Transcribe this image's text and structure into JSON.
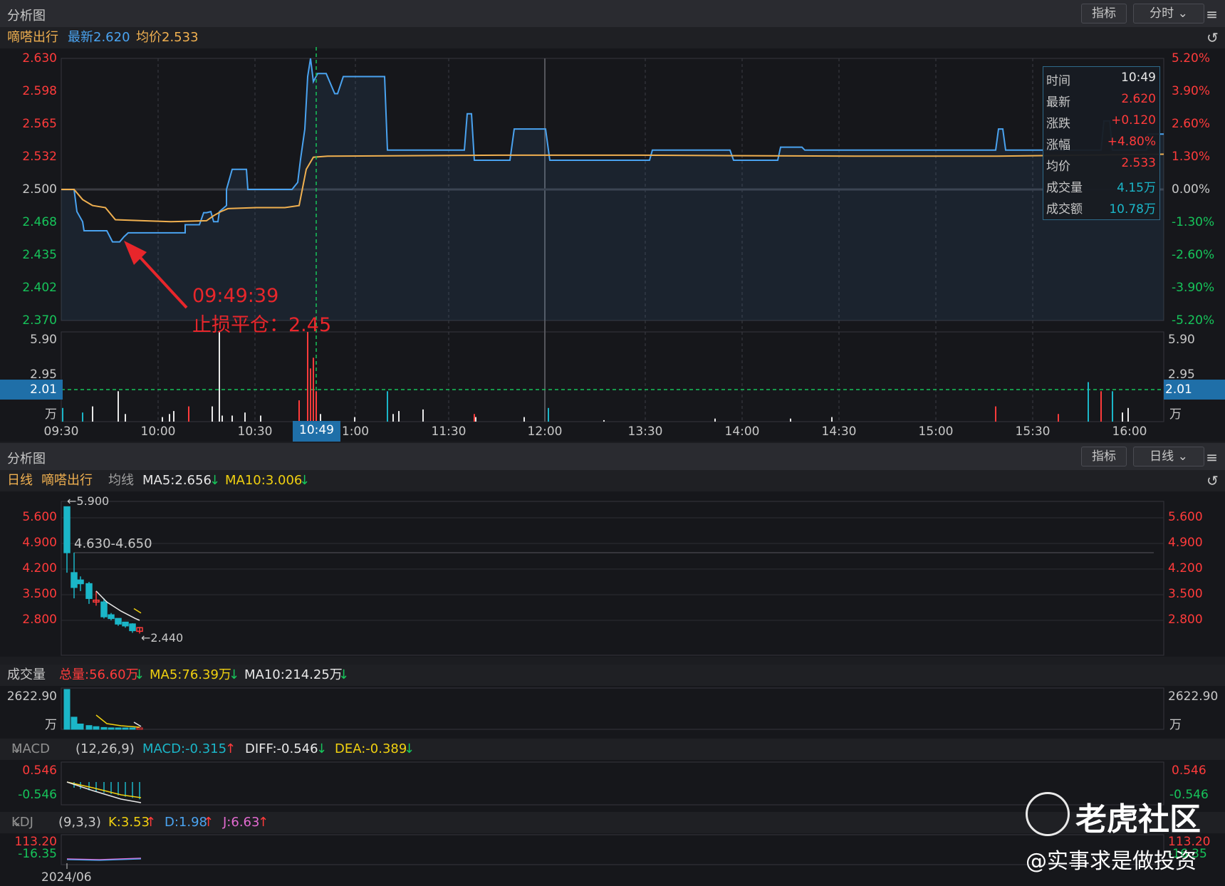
{
  "colors": {
    "up": "#ff3b3b",
    "down": "#16c45a",
    "price_line": "#4aa3f0",
    "avg_line": "#f0b050",
    "cyan": "#1bb6c8",
    "yellow": "#f0d010",
    "white": "#e8e8e8",
    "annot": "#e8262b"
  },
  "top_panel": {
    "title": "分析图",
    "btn_indicator": "指标",
    "btn_period": "分时",
    "menu_icon": "menu-icon"
  },
  "intraday_info": {
    "name": "嘀嗒出行",
    "latest": "最新2.620",
    "avg": "均价2.533"
  },
  "price_axis_left": [
    "2.630",
    "2.598",
    "2.565",
    "2.532",
    "2.500",
    "2.468",
    "2.435",
    "2.402",
    "2.370"
  ],
  "pct_axis_right": [
    "5.20%",
    "3.90%",
    "2.60%",
    "1.30%",
    "0.00%",
    "-1.30%",
    "-2.60%",
    "-3.90%",
    "-5.20%"
  ],
  "volume_axis": {
    "top": "5.90",
    "mid": "2.95",
    "cursor": "2.01",
    "unit": "万"
  },
  "time_axis": [
    "09:30",
    "10:00",
    "10:30",
    "1:00",
    "11:30",
    "12:00",
    "13:30",
    "14:00",
    "14:30",
    "15:00",
    "15:30",
    "16:00"
  ],
  "cursor_time": "10:49",
  "tooltip": [
    {
      "k": "时间",
      "v": "10:49"
    },
    {
      "k": "最新",
      "v": "2.620"
    },
    {
      "k": "涨跌",
      "v": "+0.120"
    },
    {
      "k": "涨幅",
      "v": "+4.80%"
    },
    {
      "k": "均价",
      "v": "2.533"
    },
    {
      "k": "成交量",
      "v": "4.15万"
    },
    {
      "k": "成交额",
      "v": "10.78万"
    }
  ],
  "annotation": {
    "time": "09:49:39",
    "text": "止损平仓：2.45"
  },
  "bottom_panel": {
    "title": "分析图",
    "btn_indicator": "指标",
    "btn_period": "日线"
  },
  "daily_info": {
    "period": "日线",
    "name": "嘀嗒出行",
    "ma_label": "均线",
    "ma5": "MA5:2.656",
    "ma10": "MA10:3.006"
  },
  "daily_axis": [
    "5.600",
    "4.900",
    "4.200",
    "3.500",
    "2.800"
  ],
  "daily_labels": {
    "high": "←5.900",
    "range": "4.630-4.650",
    "low": "←2.440"
  },
  "volume_info": {
    "label": "成交量",
    "total": "总量:56.60万",
    "ma5": "MA5:76.39万",
    "ma10": "MA10:214.25万"
  },
  "volume_axis2": {
    "value": "2622.90",
    "unit": "万"
  },
  "macd_info": {
    "label": "MACD",
    "params": "(12,26,9)",
    "macd": "MACD:-0.315",
    "diff": "DIFF:-0.546",
    "dea": "DEA:-0.389"
  },
  "macd_axis": {
    "top": "0.546",
    "bottom": "-0.546"
  },
  "kdj_info": {
    "label": "KDJ",
    "params": "(9,3,3)",
    "k": "K:3.53",
    "d": "D:1.98",
    "j": "J:6.63"
  },
  "kdj_axis": {
    "top": "113.20",
    "bottom": "-16.35",
    "right_bottom": "-16.35"
  },
  "date_label": "2024/06",
  "watermark": {
    "brand": "老虎社区",
    "author": "@实事求是做投资"
  }
}
